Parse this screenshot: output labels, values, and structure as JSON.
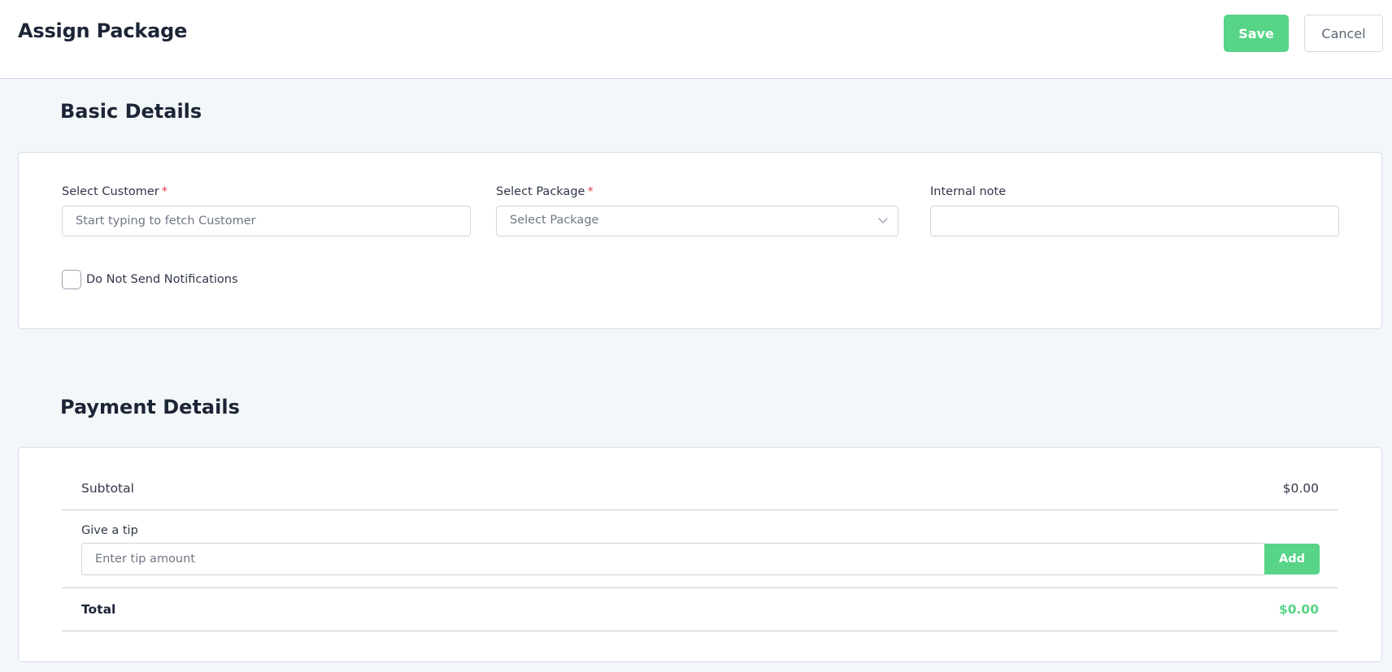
{
  "header": {
    "title": "Assign Package",
    "save_label": "Save",
    "cancel_label": "Cancel"
  },
  "basic_details": {
    "section_title": "Basic Details",
    "customer": {
      "label": "Select Customer",
      "required_mark": "*",
      "placeholder": "Start typing to fetch Customer",
      "value": ""
    },
    "package": {
      "label": "Select Package",
      "required_mark": "*",
      "selected": "Select Package"
    },
    "internal_note": {
      "label": "Internal note",
      "value": ""
    },
    "notifications_checkbox": {
      "label": "Do Not Send Notifications",
      "checked": false
    }
  },
  "payment_details": {
    "section_title": "Payment Details",
    "subtotal_label": "Subtotal",
    "subtotal_value": "$0.00",
    "tip_label": "Give a tip",
    "tip_placeholder": "Enter tip amount",
    "tip_value": "",
    "add_label": "Add",
    "total_label": "Total",
    "total_value": "$0.00"
  },
  "colors": {
    "accent": "#57d487",
    "required": "#e23b4a",
    "page_bg": "#f3f7fa"
  }
}
